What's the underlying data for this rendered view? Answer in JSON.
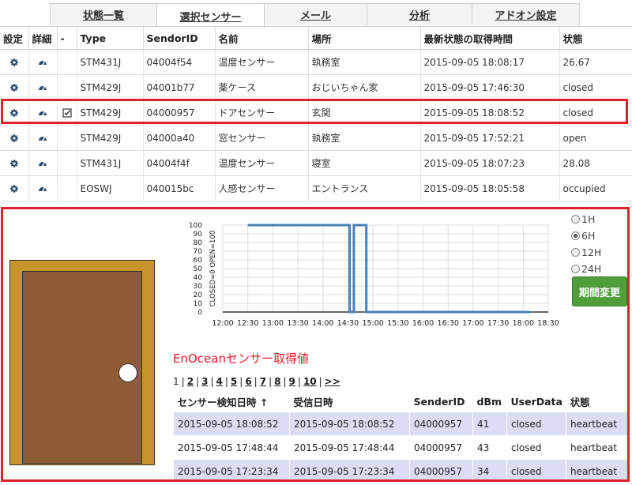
{
  "tabs": [
    {
      "label": "状態一覧"
    },
    {
      "label": "選択センサー"
    },
    {
      "label": "メール"
    },
    {
      "label": "分析"
    },
    {
      "label": "アドオン設定"
    }
  ],
  "sensor_table": {
    "headers": [
      "設定",
      "詳細",
      "-",
      "Type",
      "SendorID",
      "名前",
      "場所",
      "最新状態の取得時間",
      "状態"
    ],
    "rows": [
      {
        "type": "STM431J",
        "id": "04004f54",
        "name": "温度センサー",
        "place": "執務室",
        "time": "2015-09-05 18:08:17",
        "state": "26.67",
        "selected": false
      },
      {
        "type": "STM429J",
        "id": "04001b77",
        "name": "薬ケース",
        "place": "おじいちゃん家",
        "time": "2015-09-05 17:46:30",
        "state": "closed",
        "selected": false
      },
      {
        "type": "STM429J",
        "id": "04000957",
        "name": "ドアセンサー",
        "place": "玄関",
        "time": "2015-09-05 18:08:52",
        "state": "closed",
        "selected": true
      },
      {
        "type": "STM429J",
        "id": "04000a40",
        "name": "窓センサー",
        "place": "執務室",
        "time": "2015-09-05 17:52:21",
        "state": "open",
        "selected": false
      },
      {
        "type": "STM431J",
        "id": "04004f4f",
        "name": "温度センサー",
        "place": "寝室",
        "time": "2015-09-05 18:07:23",
        "state": "28.08",
        "selected": false
      },
      {
        "type": "EOSWJ",
        "id": "040015bc",
        "name": "人感センサー",
        "place": "エントランス",
        "time": "2015-09-05 18:05:58",
        "state": "occupied",
        "selected": false
      }
    ]
  },
  "periods": {
    "options": [
      "1H",
      "6H",
      "12H",
      "24H"
    ],
    "selected": "6H",
    "button_label": "期間変更"
  },
  "chart_data": {
    "type": "line",
    "ylabel": "CLOSED=0 OPEN=100",
    "ylim": [
      0,
      100
    ],
    "yticks": [
      "100",
      "90",
      "80",
      "70",
      "60",
      "50",
      "40",
      "30",
      "20",
      "10",
      "0"
    ],
    "xticks": [
      "12:00",
      "12:30",
      "13:00",
      "13:30",
      "14:00",
      "14:30",
      "15:00",
      "15:30",
      "16:00",
      "16:30",
      "17:00",
      "17:30",
      "18:00",
      "18:30"
    ],
    "grid": true,
    "series": [
      {
        "color": "#4a7fb5",
        "x": [
          "12:30",
          "14:32",
          "14:32",
          "14:37",
          "14:37",
          "14:52",
          "14:52",
          "18:08"
        ],
        "values": [
          100,
          100,
          0,
          0,
          100,
          100,
          0,
          0
        ]
      }
    ]
  },
  "log": {
    "title": "EnOceanセンサー取得値",
    "pager": {
      "current": "1",
      "pages": [
        "2",
        "3",
        "4",
        "5",
        "6",
        "7",
        "8",
        "9",
        "10",
        ">>"
      ]
    },
    "headers": [
      "センサー検知日時 ↑",
      "受信日時",
      "SenderID",
      "dBm",
      "UserData",
      "状態"
    ],
    "rows": [
      [
        "2015-09-05 18:08:52",
        "2015-09-05 18:08:52",
        "04000957",
        "41",
        "closed",
        "heartbeat"
      ],
      [
        "2015-09-05 17:48:44",
        "2015-09-05 17:48:44",
        "04000957",
        "43",
        "closed",
        "heartbeat"
      ],
      [
        "2015-09-05 17:23:34",
        "2015-09-05 17:23:34",
        "04000957",
        "34",
        "closed",
        "heartbeat"
      ]
    ]
  },
  "colors": {
    "highlight": "#e0202a",
    "door_frame": "#c8952a",
    "door_panel": "#8e5c34",
    "button": "#4f9e3a",
    "row_alt": "#dcdcf4"
  },
  "icons": {
    "settings": "gear-icon",
    "details": "gauge-icon",
    "selected": "checkbox-icon"
  }
}
